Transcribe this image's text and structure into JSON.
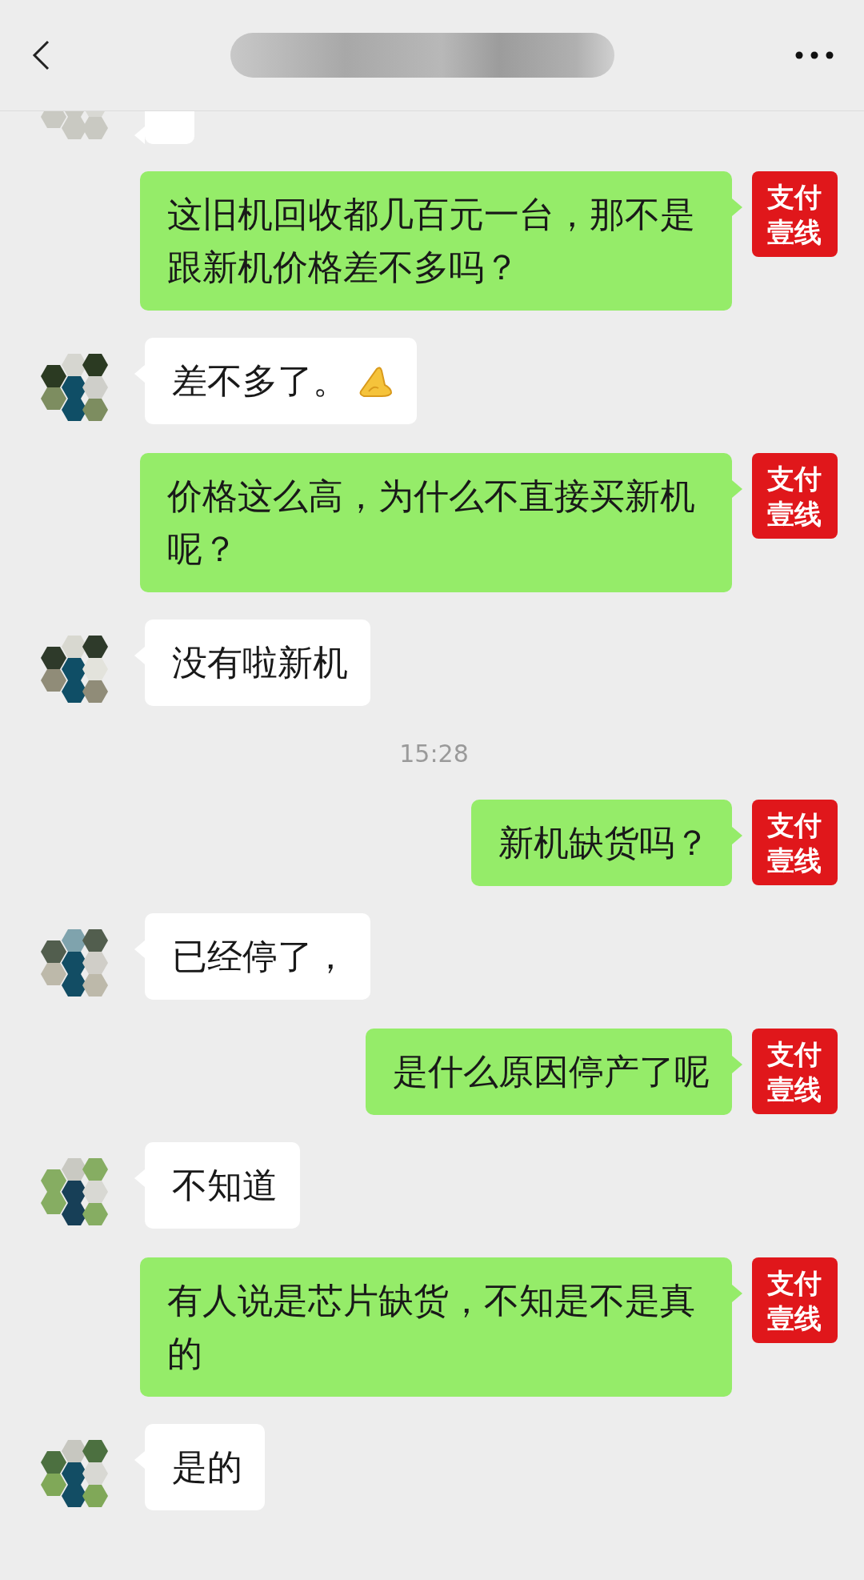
{
  "header": {
    "title_blurred": true
  },
  "messages": [
    {
      "kind": "received",
      "partial": true
    },
    {
      "kind": "sent",
      "partial": false,
      "text": "这旧机回收都几百元一台，那不是跟新机价格差不多吗？",
      "avatar_label": "支付壹线"
    },
    {
      "kind": "received",
      "partial": false,
      "text": "差不多了。",
      "emoji": true
    },
    {
      "kind": "sent",
      "partial": false,
      "text": "价格这么高，为什么不直接买新机呢？",
      "avatar_label": "支付壹线"
    },
    {
      "kind": "received",
      "partial": false,
      "text": "没有啦新机"
    },
    {
      "kind": "time",
      "text": "15:28"
    },
    {
      "kind": "sent",
      "partial": false,
      "text": "新机缺货吗？",
      "avatar_label": "支付壹线"
    },
    {
      "kind": "received",
      "partial": false,
      "text": "已经停了，"
    },
    {
      "kind": "sent",
      "partial": false,
      "text": "是什么原因停产了呢",
      "avatar_label": "支付壹线"
    },
    {
      "kind": "received",
      "partial": false,
      "text": "不知道"
    },
    {
      "kind": "sent",
      "partial": false,
      "text": "有人说是芯片缺货，不知是不是真的",
      "avatar_label": "支付壹线"
    },
    {
      "kind": "received",
      "partial": false,
      "text": "是的"
    }
  ]
}
